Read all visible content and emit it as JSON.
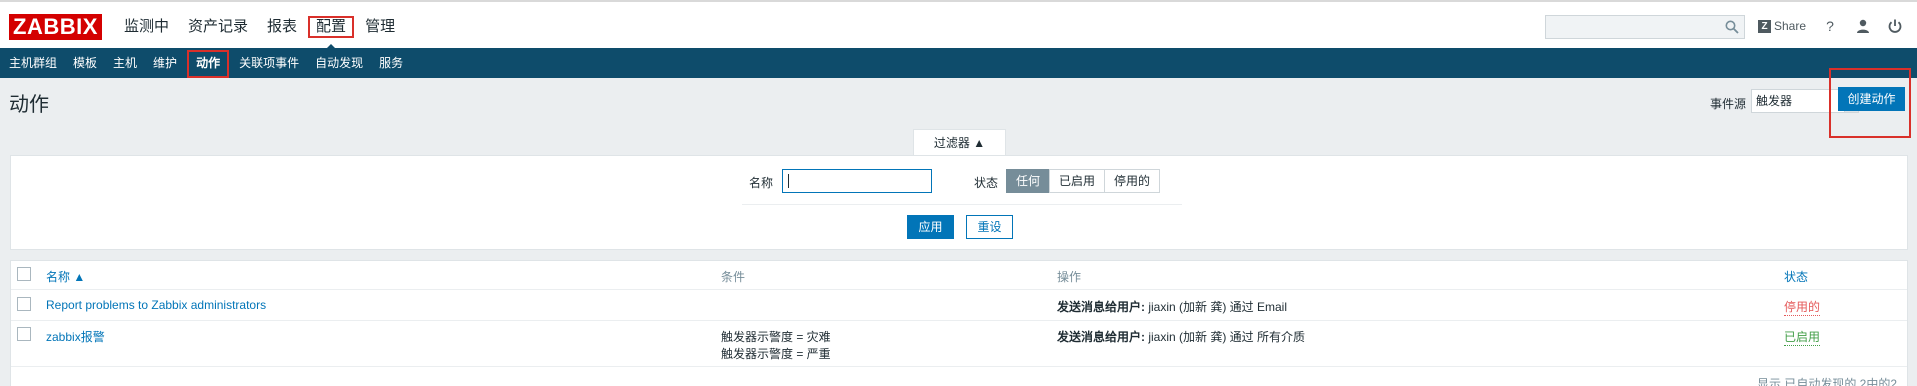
{
  "logo": "ZABBIX",
  "main_menu": [
    {
      "label": "监测中"
    },
    {
      "label": "资产记录"
    },
    {
      "label": "报表"
    },
    {
      "label": "配置"
    },
    {
      "label": "管理"
    }
  ],
  "top_right": {
    "search_value": "",
    "share_label": "Share",
    "help_glyph": "?"
  },
  "sub_menu": [
    {
      "label": "主机群组"
    },
    {
      "label": "模板"
    },
    {
      "label": "主机"
    },
    {
      "label": "维护"
    },
    {
      "label": "动作"
    },
    {
      "label": "关联项事件"
    },
    {
      "label": "自动发现"
    },
    {
      "label": "服务"
    }
  ],
  "page": {
    "title": "动作",
    "event_source_label": "事件源",
    "event_source_value": "触发器",
    "create_button": "创建动作"
  },
  "filter": {
    "tab_label": "过滤器 ▲",
    "name_label": "名称",
    "name_value": "",
    "status_label": "状态",
    "status_options": [
      "任何",
      "已启用",
      "停用的"
    ],
    "status_selected": "任何",
    "apply_label": "应用",
    "reset_label": "重设"
  },
  "table": {
    "headers": {
      "name": "名称 ▲",
      "conditions": "条件",
      "operations": "操作",
      "status": "状态"
    },
    "rows": [
      {
        "name": "Report problems to Zabbix administrators",
        "conditions": [
          "",
          ""
        ],
        "op_bold": "发送消息给用户:",
        "op_text": " jiaxin (加新 龚) 通过 Email",
        "status": "停用的",
        "status_color": "#e45959"
      },
      {
        "name": "zabbix报警",
        "conditions": [
          "触发器示警度 = 灾难",
          "触发器示警度 = 严重"
        ],
        "op_bold": "发送消息给用户:",
        "op_text": " jiaxin (加新 龚) 通过 所有介质",
        "status": "已启用",
        "status_color": "#429e47"
      }
    ]
  },
  "footer": "显示 已自动发现的 2中的2",
  "colors": {
    "brand": "#d40000",
    "nav": "#0e4c6b",
    "accent": "#0275b8",
    "highlight": "#d9302a"
  }
}
